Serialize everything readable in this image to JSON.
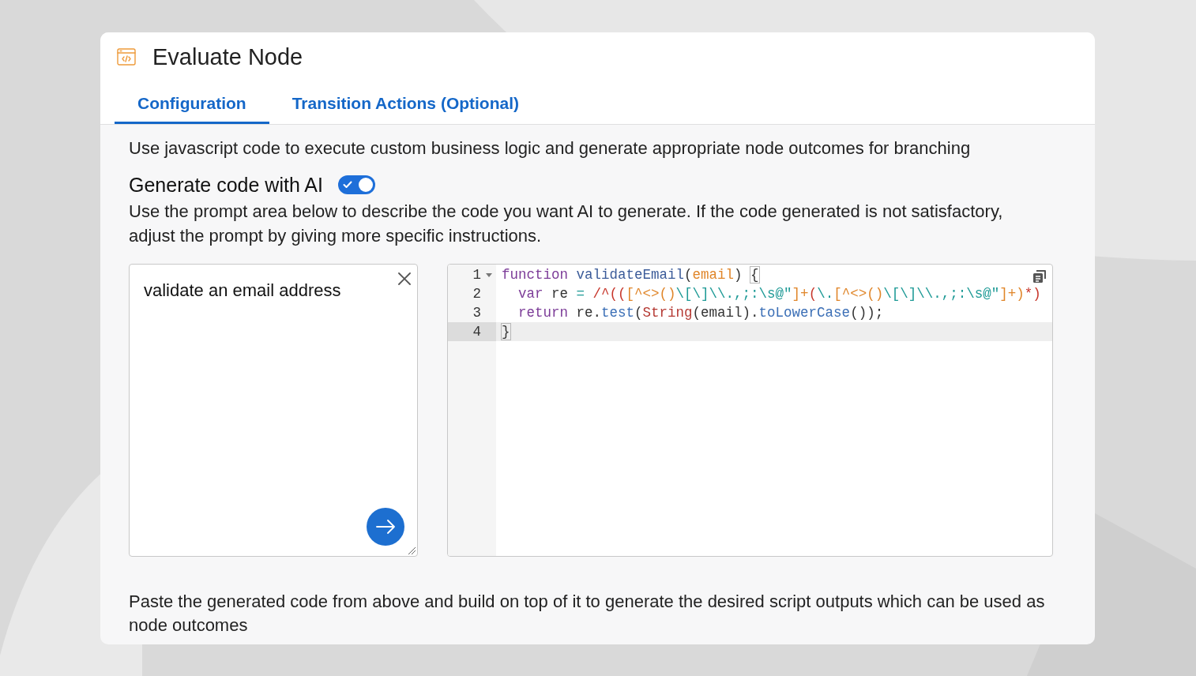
{
  "panel": {
    "title": "Evaluate Node"
  },
  "tabs": [
    {
      "label": "Configuration",
      "selected": true
    },
    {
      "label": "Transition Actions (Optional)",
      "selected": false
    }
  ],
  "description": "Use javascript code to execute custom business logic and generate appropriate node outcomes for branching",
  "ai_toggle": {
    "label": "Generate code with AI",
    "on": true
  },
  "ai_help": "Use the prompt area below to describe the code you want AI to generate. If the code generated is not satisfactory, adjust the prompt by giving more specific instructions.",
  "prompt": {
    "value": "validate an email address"
  },
  "code_editor": {
    "lines": [
      {
        "number": "1",
        "foldable": true,
        "active": false,
        "tokens": [
          {
            "text": "function ",
            "kind": "keyword"
          },
          {
            "text": "validateEmail",
            "kind": "def"
          },
          {
            "text": "(",
            "kind": "plain"
          },
          {
            "text": "email",
            "kind": "param"
          },
          {
            "text": ") ",
            "kind": "plain"
          },
          {
            "text": "{",
            "kind": "brace-match"
          }
        ]
      },
      {
        "number": "2",
        "foldable": false,
        "active": false,
        "tokens": [
          {
            "text": "  var",
            "kind": "keyword"
          },
          {
            "text": " re ",
            "kind": "plain"
          },
          {
            "text": "=",
            "kind": "operator"
          },
          {
            "text": " /^((",
            "kind": "regex"
          },
          {
            "text": "[^<>()",
            "kind": "regex-set"
          },
          {
            "text": "\\[\\]\\\\.,;:\\s@\"",
            "kind": "regex-escape"
          },
          {
            "text": "]+",
            "kind": "regex-set"
          },
          {
            "text": "(",
            "kind": "regex"
          },
          {
            "text": "\\.",
            "kind": "regex-escape"
          },
          {
            "text": "[^<>()",
            "kind": "regex-set"
          },
          {
            "text": "\\[\\]\\\\.,;:\\s@\"",
            "kind": "regex-escape"
          },
          {
            "text": "]+)",
            "kind": "regex-set"
          },
          {
            "text": "*)",
            "kind": "regex"
          }
        ]
      },
      {
        "number": "3",
        "foldable": false,
        "active": false,
        "tokens": [
          {
            "text": "  return",
            "kind": "keyword"
          },
          {
            "text": " re.",
            "kind": "plain"
          },
          {
            "text": "test",
            "kind": "property"
          },
          {
            "text": "(",
            "kind": "plain"
          },
          {
            "text": "String",
            "kind": "builtin"
          },
          {
            "text": "(email).",
            "kind": "plain"
          },
          {
            "text": "toLowerCase",
            "kind": "property"
          },
          {
            "text": "());",
            "kind": "plain"
          }
        ]
      },
      {
        "number": "4",
        "foldable": false,
        "active": true,
        "tokens": [
          {
            "text": "}",
            "kind": "brace-match"
          }
        ]
      }
    ]
  },
  "footer_note": "Paste the generated code from above and build on top of it to generate the desired script outputs which can be used as node outcomes"
}
